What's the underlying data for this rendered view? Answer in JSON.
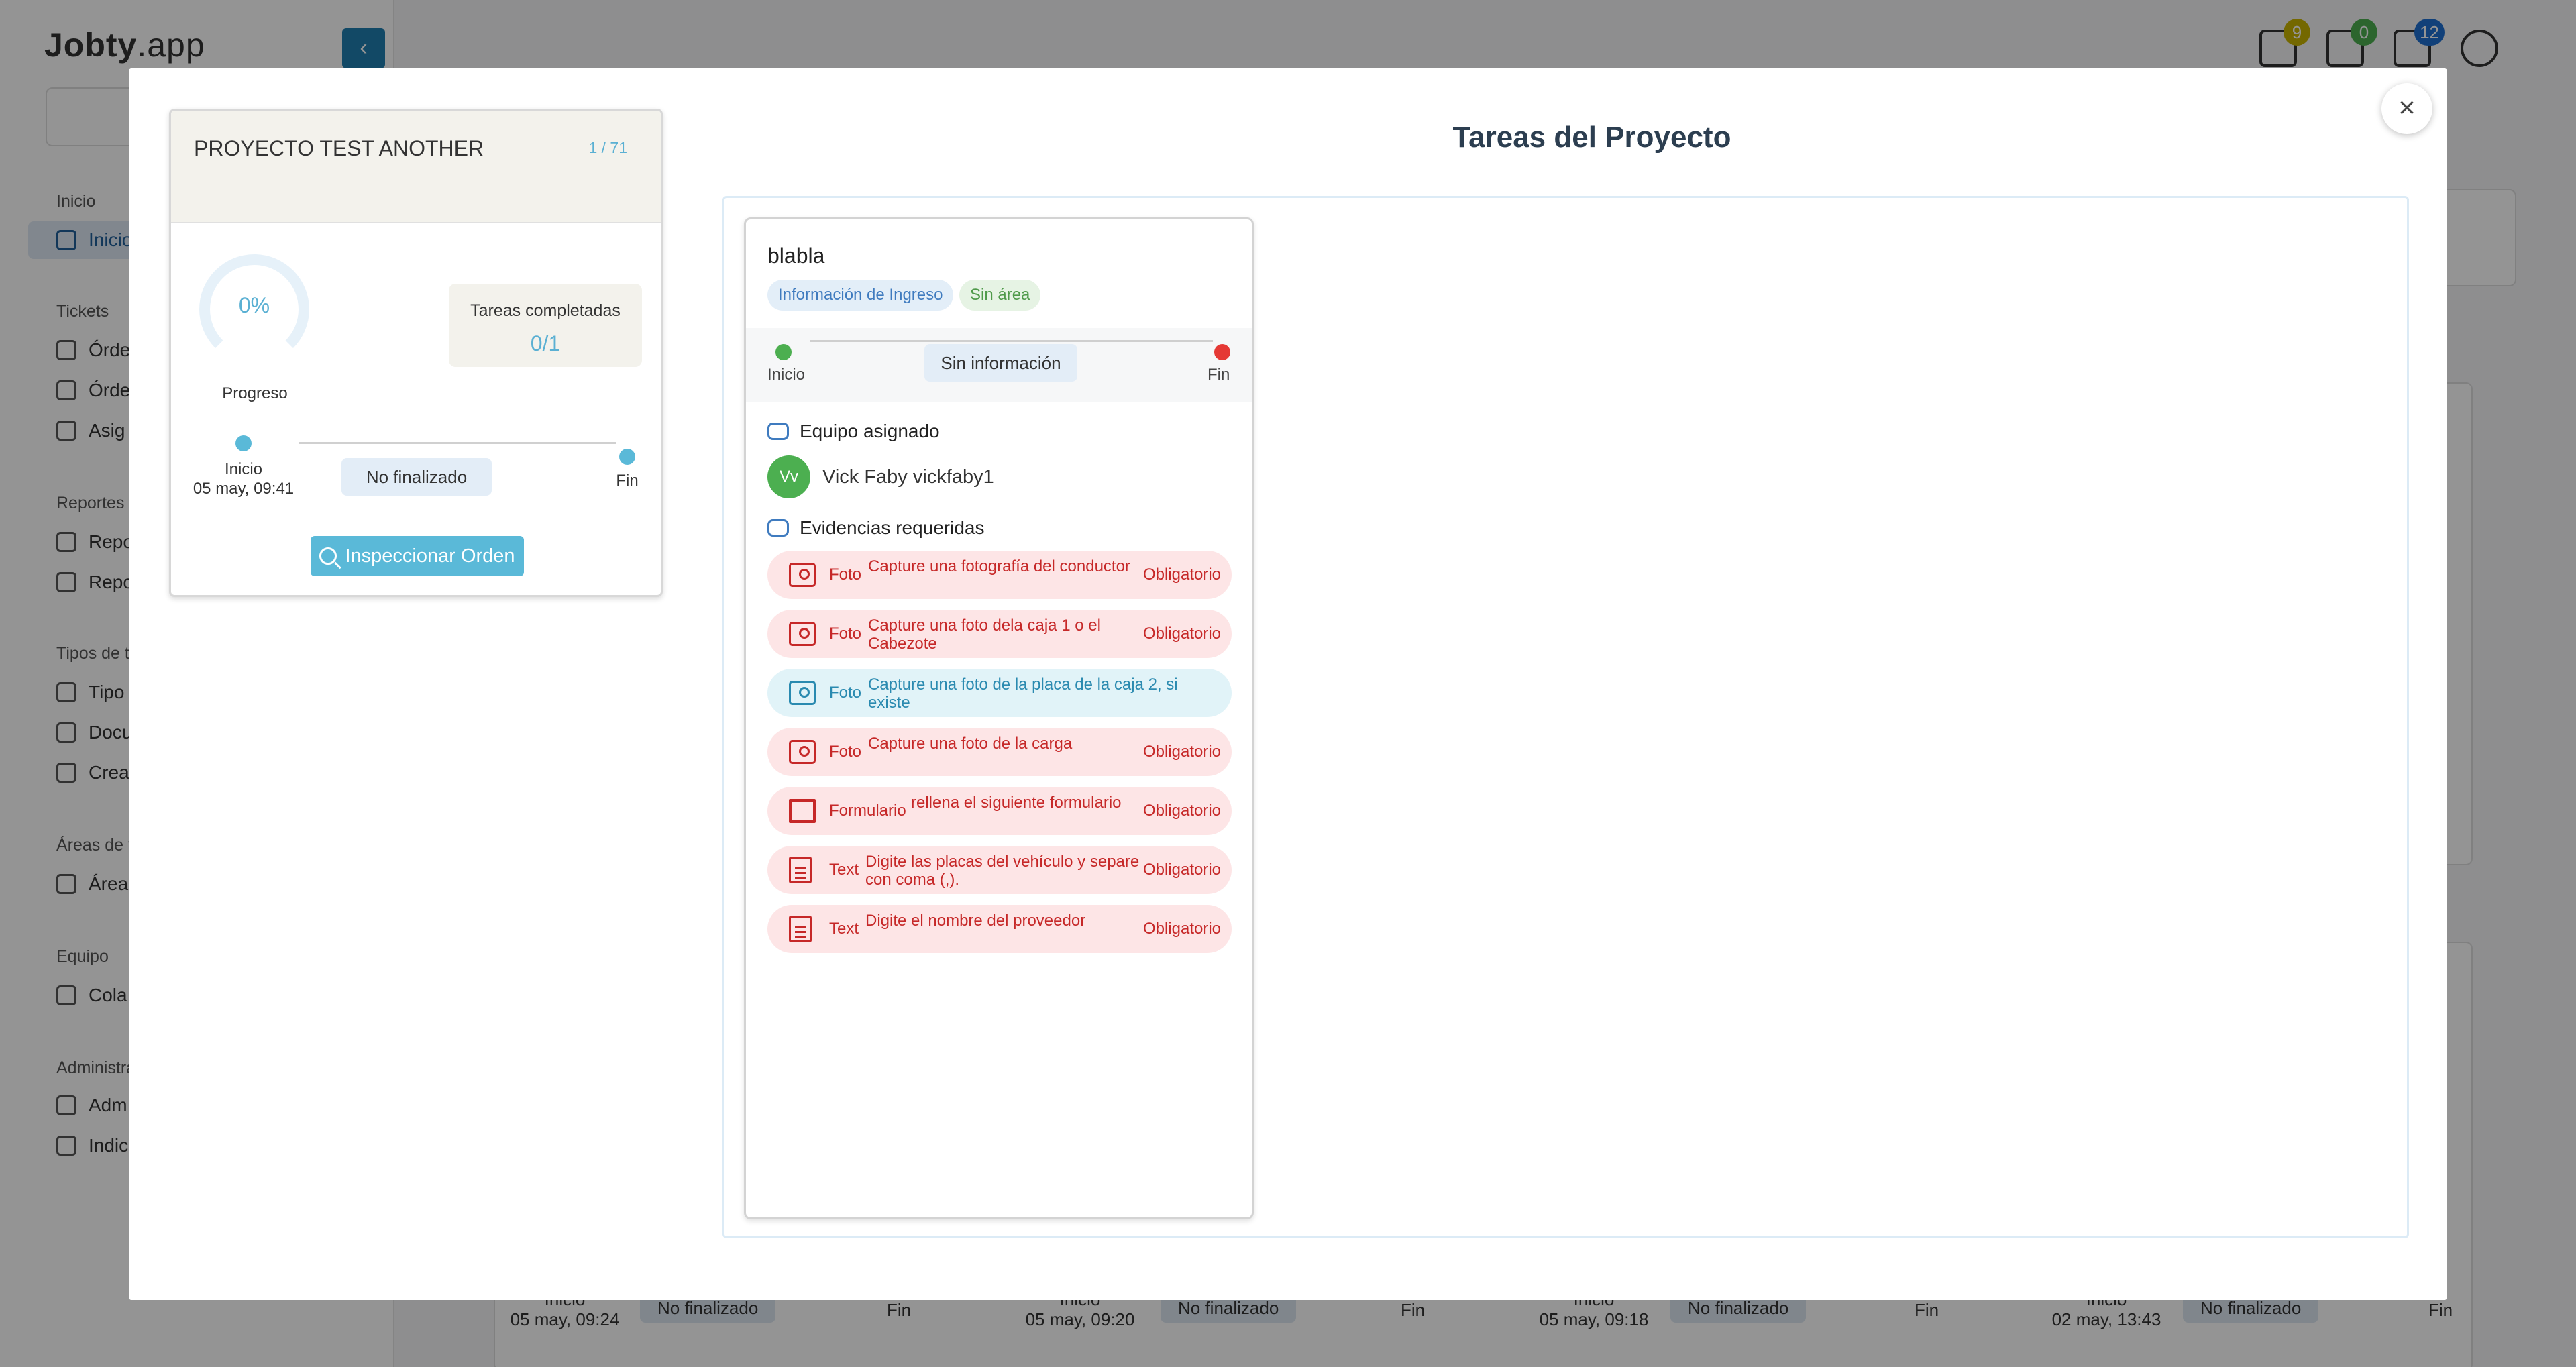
{
  "background": {
    "logo": {
      "main": "Jobty",
      "suffix": ".app"
    },
    "sidebar": {
      "sections": [
        {
          "title": "Inicio",
          "items": [
            "Inicio"
          ]
        },
        {
          "title": "Tickets",
          "items": [
            "Órde",
            "Órde",
            "Asig"
          ]
        },
        {
          "title": "Reportes",
          "items": [
            "Repo",
            "Repo"
          ]
        },
        {
          "title": "Tipos de t",
          "items": [
            "Tipo",
            "Docu",
            "Crea"
          ]
        },
        {
          "title": "Áreas de t",
          "items": [
            "Área"
          ]
        },
        {
          "title": "Equipo",
          "items": [
            "Cola"
          ]
        },
        {
          "title": "Administra",
          "items": [
            "Adm",
            "Indic"
          ]
        }
      ]
    },
    "topbar": {
      "badges": [
        {
          "icon": "building-icon",
          "count": "9",
          "color": "#c8b400"
        },
        {
          "icon": "mail-icon",
          "count": "0",
          "color": "#4caf50"
        },
        {
          "icon": "inbox-icon",
          "count": "12",
          "color": "#1e6fd0"
        }
      ]
    },
    "bottom_cards": [
      {
        "start": "Inicio",
        "date": "05 may, 09:24",
        "status": "No finalizado",
        "end": "Fin"
      },
      {
        "start": "Inicio",
        "date": "05 may, 09:20",
        "status": "No finalizado",
        "end": "Fin"
      },
      {
        "start": "Inicio",
        "date": "05 may, 09:18",
        "status": "No finalizado",
        "end": "Fin"
      },
      {
        "start": "Inicio",
        "date": "02 may, 13:43",
        "status": "No finalizado",
        "end": "Fin"
      }
    ]
  },
  "modal": {
    "title": "Tareas del Proyecto",
    "close_icon": "×",
    "project": {
      "name": "PROYECTO TEST ANOTHER",
      "counter": "1 / 71",
      "progress_pct": "0%",
      "progress_label": "Progreso",
      "tasks_label": "Tareas completadas",
      "tasks_value": "0/1",
      "start_label": "Inicio",
      "start_date": "05 may, 09:41",
      "status": "No finalizado",
      "end_label": "Fin",
      "inspect_button": "Inspeccionar Orden"
    },
    "task": {
      "name": "blabla",
      "tag_info": "Información de Ingreso",
      "tag_area": "Sin área",
      "start_label": "Inicio",
      "end_label": "Fin",
      "status": "Sin información",
      "team_title": "Equipo asignado",
      "member_initials": "Vv",
      "member_name": "Vick Faby vickfaby1",
      "evidence_title": "Evidencias requeridas",
      "evidences": [
        {
          "type": "Foto",
          "icon": "photo-icon",
          "desc": "Capture una fotografía del conductor",
          "required": "Obligatorio"
        },
        {
          "type": "Foto",
          "icon": "photo-icon",
          "desc": "Capture una foto dela caja 1 o el Cabezote",
          "required": "Obligatorio"
        },
        {
          "type": "Foto",
          "icon": "photo-icon",
          "desc": "Capture una foto de la placa de la caja 2, si existe",
          "required": ""
        },
        {
          "type": "Foto",
          "icon": "photo-icon",
          "desc": "Capture una foto de la carga",
          "required": "Obligatorio"
        },
        {
          "type": "Formulario",
          "icon": "form-icon",
          "desc": "rellena el siguiente formulario",
          "required": "Obligatorio"
        },
        {
          "type": "Text",
          "icon": "text-icon",
          "desc": "Digite las placas del vehículo y separe con coma (,).",
          "required": "Obligatorio"
        },
        {
          "type": "Text",
          "icon": "text-icon",
          "desc": "Digite el nombre del proveedor",
          "required": "Obligatorio"
        }
      ]
    }
  }
}
